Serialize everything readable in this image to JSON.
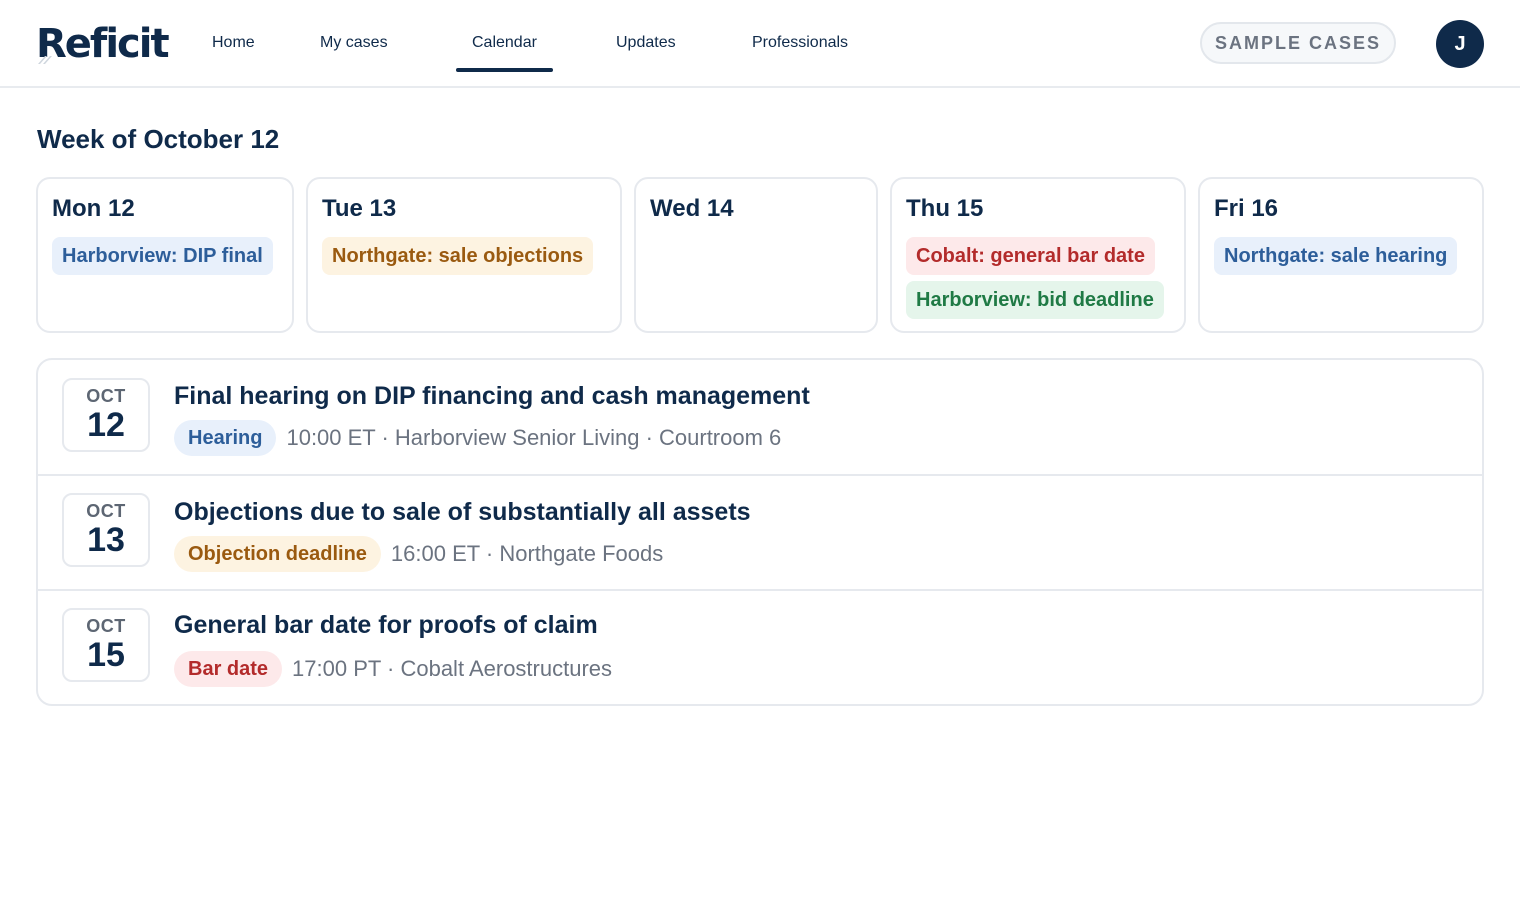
{
  "brand": {
    "name": "Reficit"
  },
  "nav": {
    "items": [
      {
        "label": "Home"
      },
      {
        "label": "My cases"
      },
      {
        "label": "Calendar"
      },
      {
        "label": "Updates"
      },
      {
        "label": "Professionals"
      }
    ],
    "active": "Calendar"
  },
  "header": {
    "sample_label": "SAMPLE CASES",
    "avatar_initial": "J"
  },
  "week": {
    "title": "Week of October 12",
    "days": [
      {
        "label": "Mon 12",
        "items": [
          {
            "text": "Harborview: DIP final",
            "tone": "blue"
          }
        ]
      },
      {
        "label": "Tue 13",
        "items": [
          {
            "text": "Northgate: sale objections",
            "tone": "amber"
          }
        ]
      },
      {
        "label": "Wed 14",
        "items": []
      },
      {
        "label": "Thu 15",
        "items": [
          {
            "text": "Cobalt: general bar date",
            "tone": "red"
          },
          {
            "text": "Harborview: bid deadline",
            "tone": "green"
          }
        ]
      },
      {
        "label": "Fri 16",
        "items": [
          {
            "text": "Northgate: sale hearing",
            "tone": "blue"
          }
        ]
      }
    ]
  },
  "events": [
    {
      "month": "OCT",
      "day": "12",
      "title": "Final hearing on DIP financing and cash management",
      "tag": "Hearing",
      "tone": "blue",
      "detail": "10:00 ET · Harborview Senior Living · Courtroom 6"
    },
    {
      "month": "OCT",
      "day": "13",
      "title": "Objections due to sale of substantially all assets",
      "tag": "Objection deadline",
      "tone": "amber",
      "detail": "16:00 ET · Northgate Foods"
    },
    {
      "month": "OCT",
      "day": "15",
      "title": "General bar date for proofs of claim",
      "tag": "Bar date",
      "tone": "red",
      "detail": "17:00 PT · Cobalt Aerostructures"
    }
  ],
  "colors": {
    "brand_navy": "#0f2a4a",
    "muted": "#6b7380",
    "border": "#e6e9ee"
  }
}
